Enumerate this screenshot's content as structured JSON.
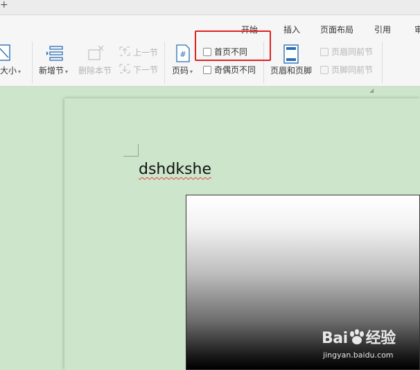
{
  "window": {
    "titlebar_glyph": "+"
  },
  "ribbon": {
    "tabs": [
      "开始",
      "插入",
      "页面布局",
      "引用",
      "审"
    ],
    "groups": {
      "size_label": "大小",
      "new_section_label": "新增节",
      "delete_section_label": "删除本节",
      "prev_section_label": "上一节",
      "next_section_label": "下一节",
      "page_number_label": "页码",
      "header_footer_label": "页眉和页脚",
      "first_page_different_label": "首页不同",
      "odd_even_different_label": "奇偶页不同",
      "header_same_as_prev_label": "页眉同前节",
      "footer_same_as_prev_label": "页脚同前节"
    },
    "checkboxes": {
      "first_page_different": false,
      "odd_even_different": false,
      "header_same_as_prev": false,
      "footer_same_as_prev": false
    },
    "icons": {
      "size": "page-size-icon",
      "new_section": "new-section-icon",
      "delete_section": "delete-section-icon",
      "page_number": "page-number-icon",
      "header_footer": "header-footer-icon"
    }
  },
  "document": {
    "body_text": "dshdkshe",
    "image": "gradient-image"
  },
  "watermark": {
    "logo_text_1": "Bai",
    "logo_text_2": "经验",
    "url": "jingyan.baidu.com"
  },
  "colors": {
    "page_background": "#cde6cb",
    "highlight_border": "#e02020",
    "spell_underline": "#e04040"
  }
}
